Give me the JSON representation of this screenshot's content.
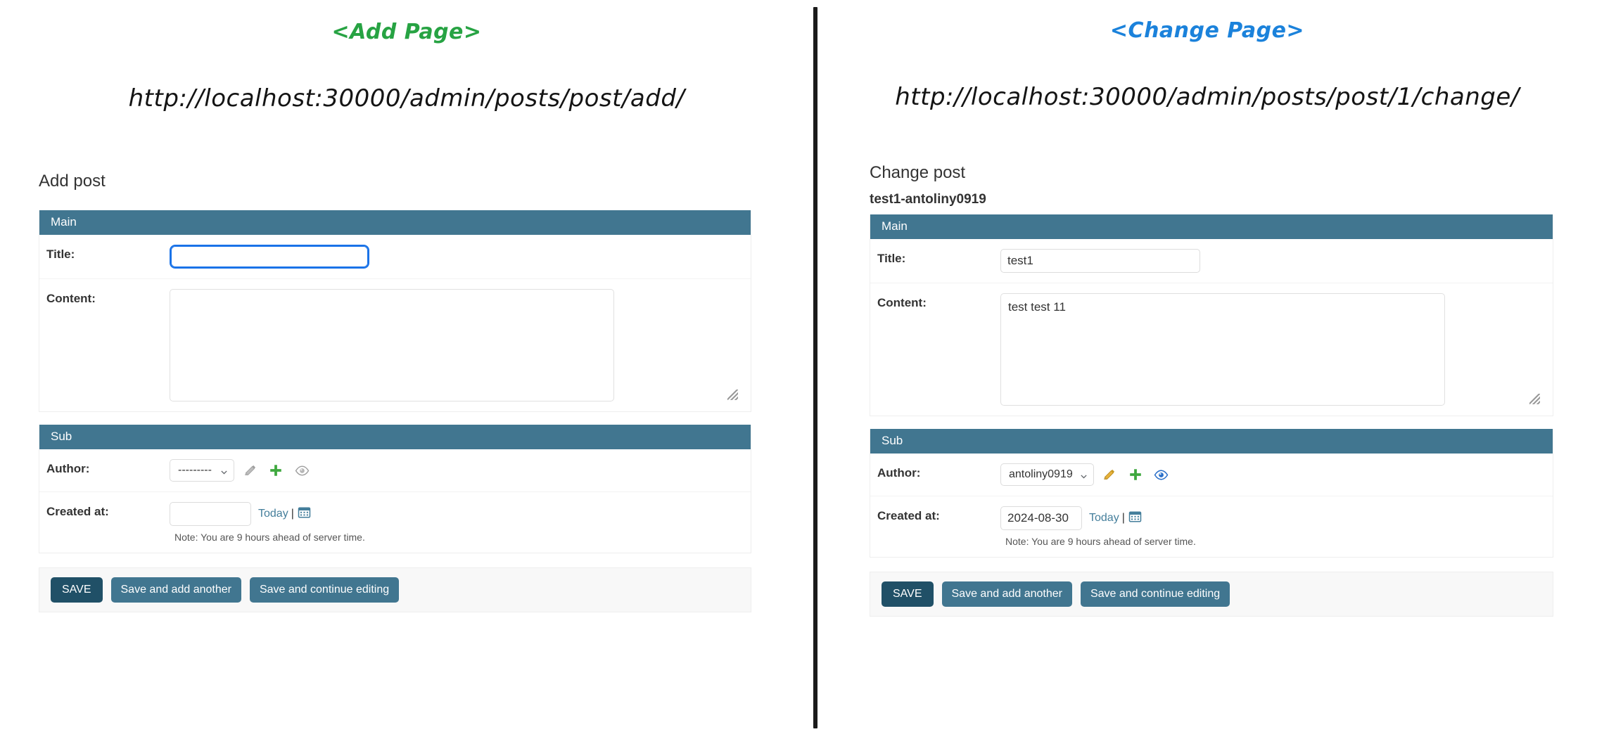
{
  "divider": {
    "color": "#1b1b1b"
  },
  "panels": {
    "add": {
      "annotation_title": "<Add Page>",
      "annotation_color": "#27a343",
      "url": "http://localhost:30000/admin/posts/post/add/",
      "page_heading": "Add post",
      "object_name": "",
      "fieldsets": [
        {
          "legend": "Main",
          "rows": [
            {
              "label": "Title:",
              "type": "text",
              "value": "",
              "focused": true
            },
            {
              "label": "Content:",
              "type": "textarea",
              "value": ""
            }
          ]
        },
        {
          "legend": "Sub",
          "rows": [
            {
              "label": "Author:",
              "type": "select",
              "value": "---------",
              "icons": [
                "pencil-icon",
                "plus-icon",
                "eye-icon"
              ],
              "icon_state": "inactive"
            },
            {
              "label": "Created at:",
              "type": "date",
              "value": "",
              "today_label": "Today",
              "note": "Note: You are 9 hours ahead of server time."
            }
          ]
        }
      ],
      "buttons": [
        {
          "label": "SAVE",
          "style": "default"
        },
        {
          "label": "Save and add another",
          "style": "normal"
        },
        {
          "label": "Save and continue editing",
          "style": "normal"
        }
      ]
    },
    "change": {
      "annotation_title": "<Change Page>",
      "annotation_color": "#1b82db",
      "url": "http://localhost:30000/admin/posts/post/1/change/",
      "page_heading": "Change post",
      "object_name": "test1-antoliny0919",
      "fieldsets": [
        {
          "legend": "Main",
          "rows": [
            {
              "label": "Title:",
              "type": "text",
              "value": "test1",
              "focused": false
            },
            {
              "label": "Content:",
              "type": "textarea",
              "value": "test test 11"
            }
          ]
        },
        {
          "legend": "Sub",
          "rows": [
            {
              "label": "Author:",
              "type": "select",
              "value": "antoliny0919",
              "icons": [
                "pencil-icon",
                "plus-icon",
                "eye-icon"
              ],
              "icon_state": "active"
            },
            {
              "label": "Created at:",
              "type": "date",
              "value": "2024-08-30",
              "today_label": "Today",
              "note": "Note: You are 9 hours ahead of server time."
            }
          ]
        }
      ],
      "buttons": [
        {
          "label": "SAVE",
          "style": "default"
        },
        {
          "label": "Save and add another",
          "style": "normal"
        },
        {
          "label": "Save and continue editing",
          "style": "normal"
        }
      ]
    }
  },
  "colors": {
    "fieldset_header": "#417690",
    "save_default": "#205067",
    "link": "#447e9b",
    "plus_green": "#3fa83f",
    "pencil_active": "#d9a21b",
    "pencil_inactive": "#9e9e9e",
    "eye_active": "#2a6fc9",
    "eye_inactive": "#9e9e9e",
    "focus_ring": "#1a73e8"
  }
}
